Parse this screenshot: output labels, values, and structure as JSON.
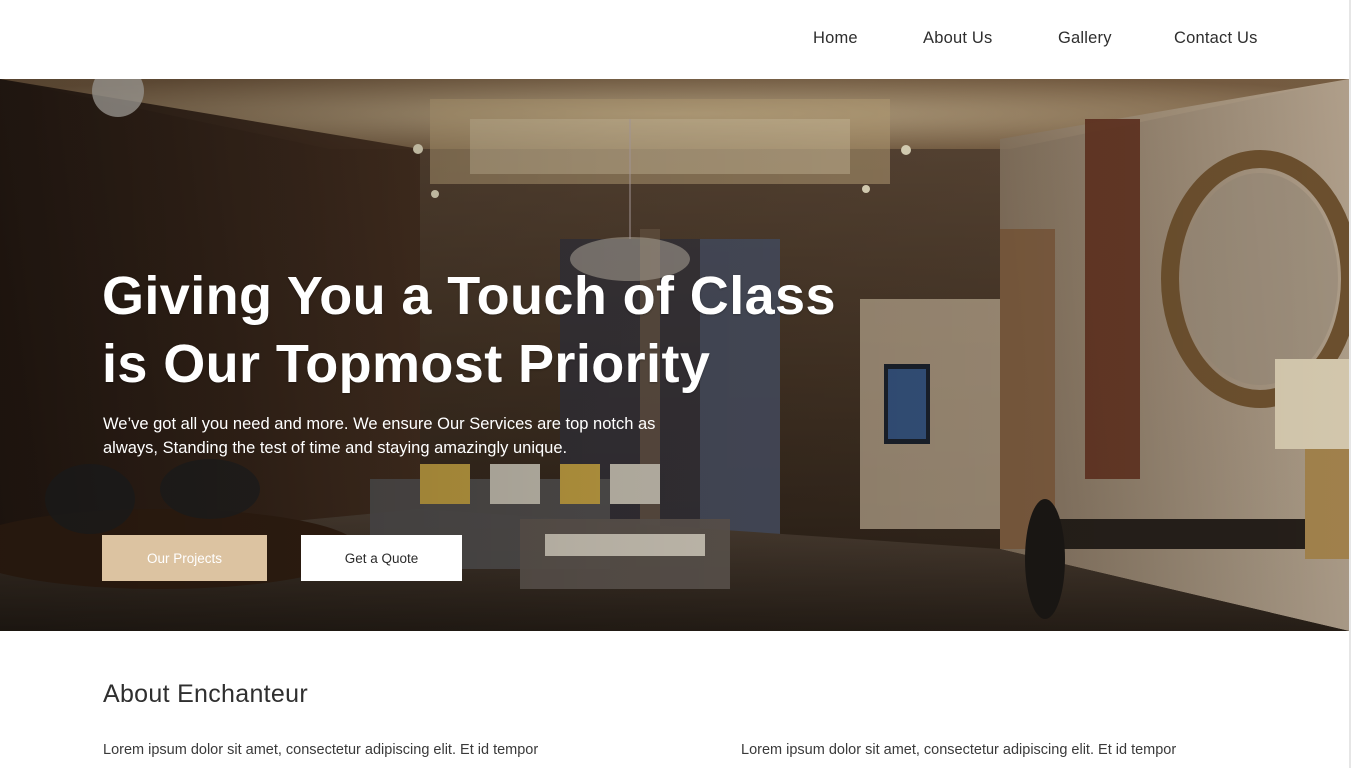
{
  "nav": {
    "items": [
      {
        "label": "Home"
      },
      {
        "label": "About Us"
      },
      {
        "label": "Gallery"
      },
      {
        "label": "Contact Us"
      }
    ]
  },
  "hero": {
    "title_line1": "Giving You a Touch of Class",
    "title_line2": "is Our Topmost Priority",
    "subtitle": "We’ve got all you need and more. We ensure Our Services are top notch as always, Standing the test of time and staying amazingly unique.",
    "primary_button": "Our Projects",
    "secondary_button": "Get a Quote"
  },
  "about": {
    "title": "About Enchanteur",
    "col_left": "Lorem ipsum dolor sit amet, consectetur adipiscing elit. Et id tempor",
    "col_right": "Lorem ipsum dolor sit amet, consectetur adipiscing elit. Et id tempor"
  },
  "colors": {
    "accent": "#dcc3a1",
    "text": "#2b2b2b",
    "hero_overlay": "#3a2c20"
  }
}
